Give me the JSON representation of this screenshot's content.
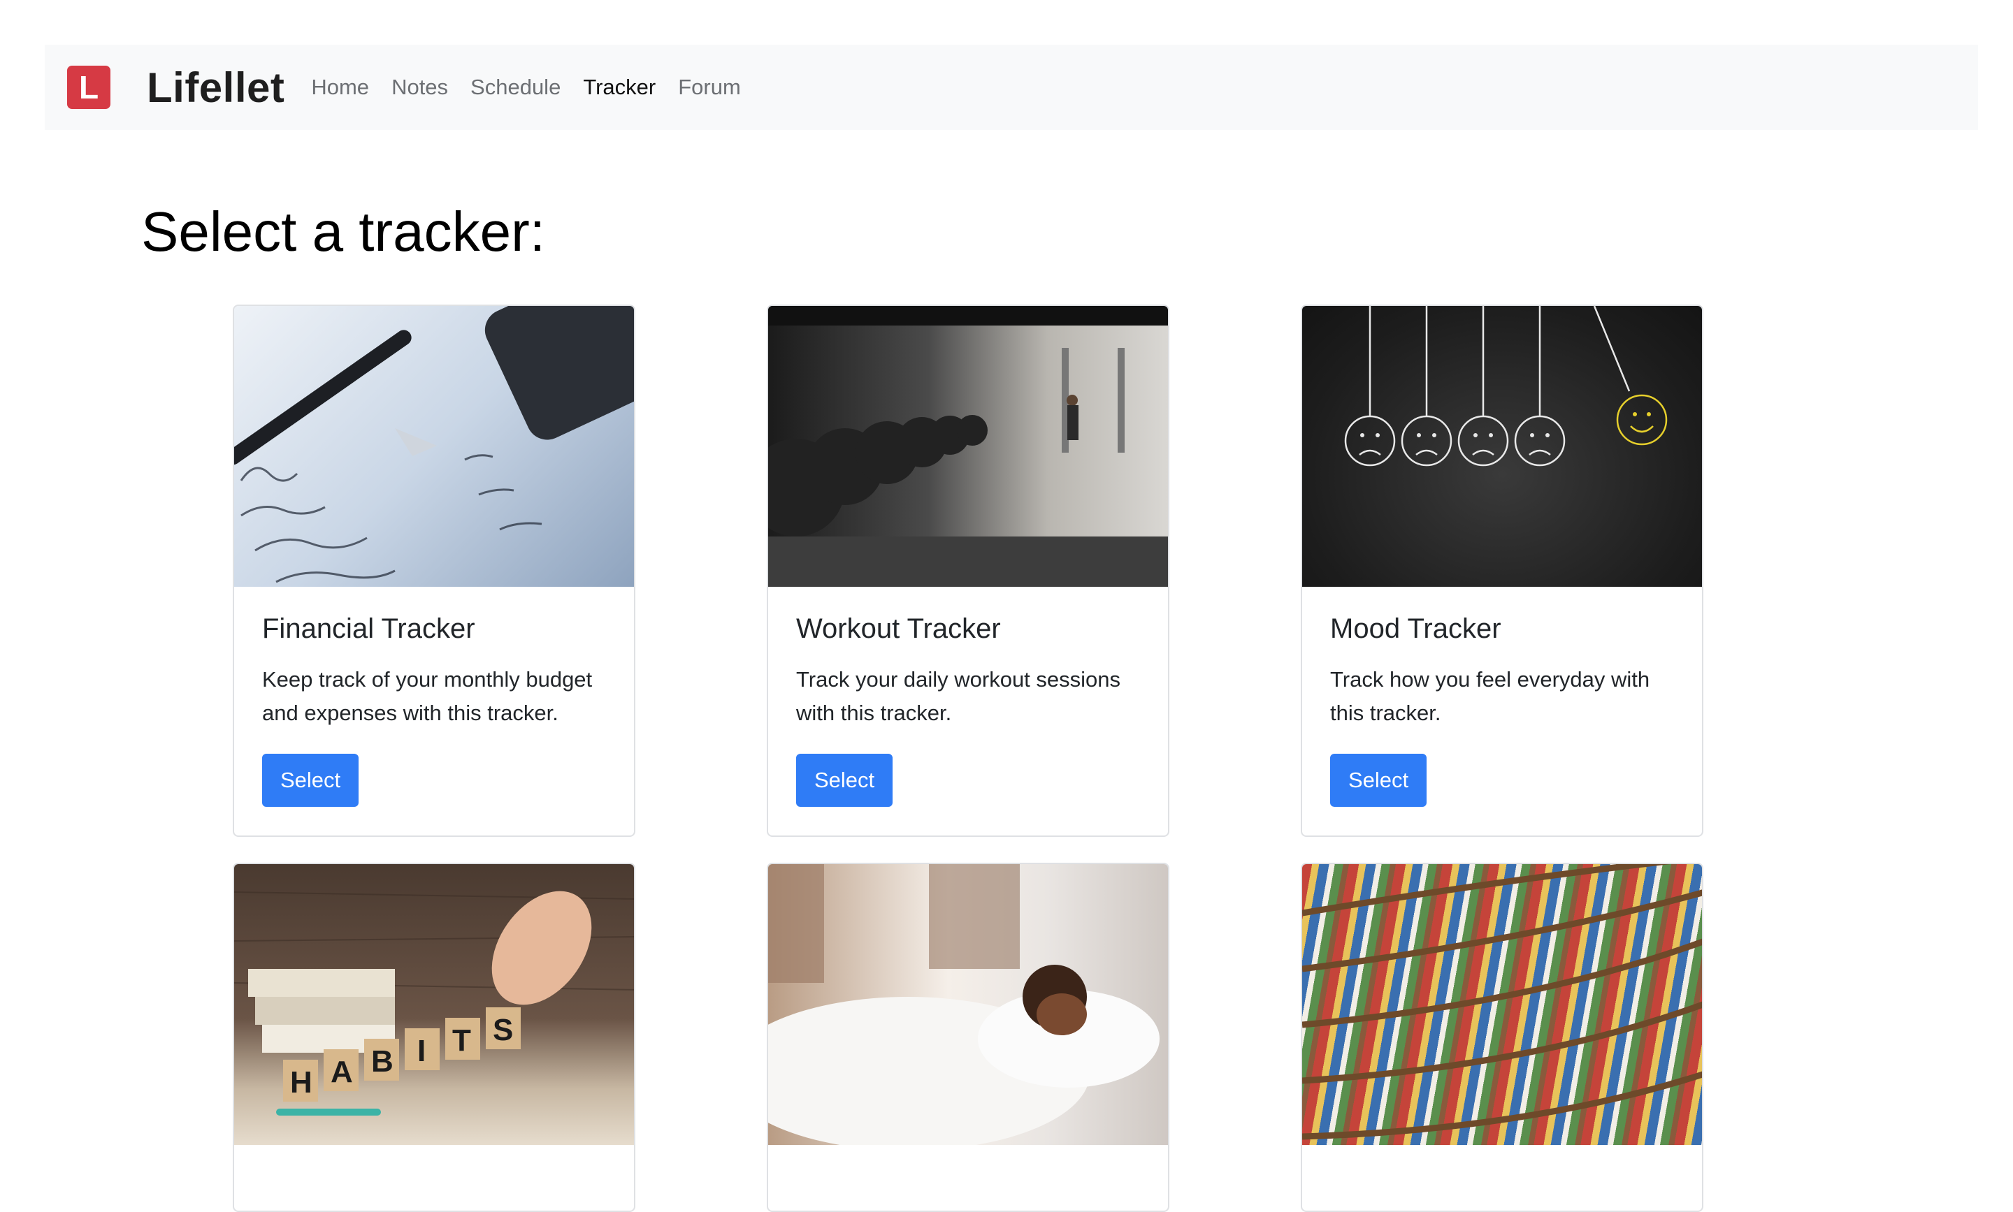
{
  "navbar": {
    "logo_letter": "L",
    "brand": "Lifellet",
    "links": [
      {
        "label": "Home",
        "active": false
      },
      {
        "label": "Notes",
        "active": false
      },
      {
        "label": "Schedule",
        "active": false
      },
      {
        "label": "Tracker",
        "active": true
      },
      {
        "label": "Forum",
        "active": false
      }
    ]
  },
  "page": {
    "title": "Select a tracker:"
  },
  "cards": [
    {
      "title": "Financial Tracker",
      "text": "Keep track of your monthly budget and expenses with this tracker.",
      "button": "Select",
      "image": "finance-notes-image"
    },
    {
      "title": "Workout Tracker",
      "text": "Track your daily workout sessions with this tracker.",
      "button": "Select",
      "image": "gym-dumbbells-image"
    },
    {
      "title": "Mood Tracker",
      "text": "Track how you feel everyday with this tracker.",
      "button": "Select",
      "image": "mood-faces-image"
    },
    {
      "image": "habits-blocks-image",
      "image_text": "HABITS"
    },
    {
      "image": "sleeping-person-image"
    },
    {
      "image": "bookshelf-image"
    }
  ],
  "colors": {
    "accent": "#2f7cf6",
    "logo": "#d63a44",
    "navbar_bg": "#f8f9fa"
  }
}
